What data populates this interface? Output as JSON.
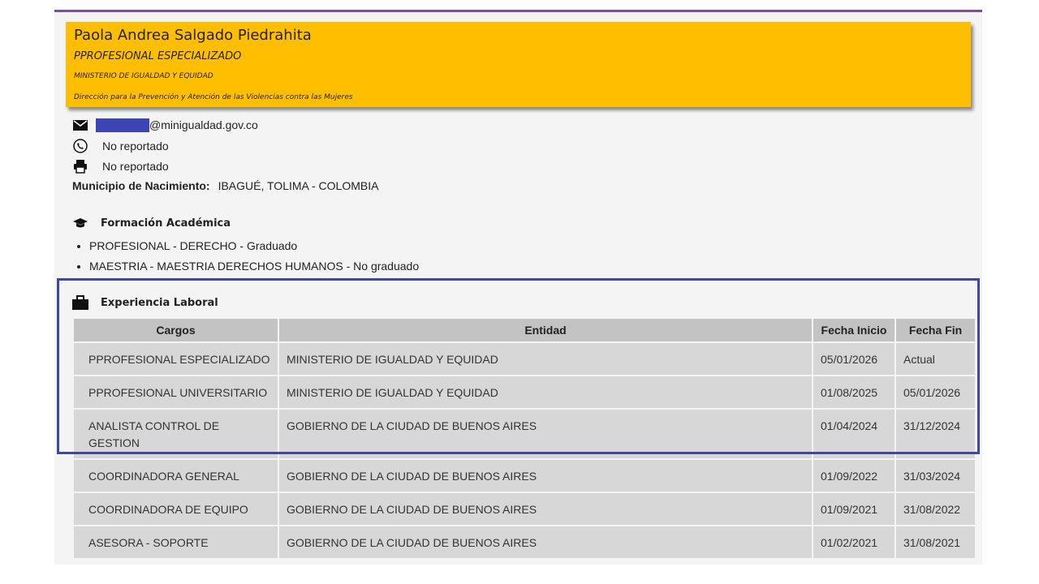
{
  "profile": {
    "name": "Paola Andrea Salgado Piedrahita",
    "role": "PPROFESIONAL ESPECIALIZADO",
    "organization": "MINISTERIO DE IGUALDAD Y EQUIDAD",
    "department": "Dirección para la Prevención y Atención de las Violencias contra las Mujeres"
  },
  "contact": {
    "email_domain": "@minigualdad.gov.co",
    "phone": "No reportado",
    "fax": "No reportado",
    "birthplace_label": "Municipio de Nacimiento:",
    "birthplace": "IBAGUÉ, TOLIMA - COLOMBIA"
  },
  "education": {
    "title": "Formación Académica",
    "items": [
      "PROFESIONAL - DERECHO - Graduado",
      "MAESTRIA - MAESTRIA DERECHOS HUMANOS - No graduado"
    ]
  },
  "experience": {
    "title": "Experiencia Laboral",
    "headers": [
      "Cargos",
      "Entidad",
      "Fecha Inicio",
      "Fecha Fin"
    ],
    "rows": [
      {
        "cargo": "PPROFESIONAL ESPECIALIZADO",
        "entidad": "MINISTERIO DE IGUALDAD Y EQUIDAD",
        "inicio": "05/01/2026",
        "fin": "Actual"
      },
      {
        "cargo": "PPROFESIONAL UNIVERSITARIO",
        "entidad": "MINISTERIO DE IGUALDAD Y EQUIDAD",
        "inicio": "01/08/2025",
        "fin": "05/01/2026"
      },
      {
        "cargo": "ANALISTA CONTROL DE GESTION",
        "entidad": "GOBIERNO DE LA CIUDAD DE BUENOS AIRES",
        "inicio": "01/04/2024",
        "fin": "31/12/2024"
      },
      {
        "cargo": "COORDINADORA GENERAL",
        "entidad": "GOBIERNO DE LA CIUDAD DE BUENOS AIRES",
        "inicio": "01/09/2022",
        "fin": "31/03/2024"
      },
      {
        "cargo": "COORDINADORA DE EQUIPO",
        "entidad": "GOBIERNO DE LA CIUDAD DE BUENOS AIRES",
        "inicio": "01/09/2021",
        "fin": "31/08/2022"
      },
      {
        "cargo": "ASESORA - SOPORTE",
        "entidad": "GOBIERNO DE LA CIUDAD DE BUENOS AIRES",
        "inicio": "01/02/2021",
        "fin": "31/08/2021"
      }
    ]
  },
  "colors": {
    "card": "#ffbf00",
    "highlight": "#3e47a6",
    "redaction": "#3b46b4",
    "top_rule": "#7b4f9d"
  },
  "icons": [
    "envelope-icon",
    "phone-icon",
    "printer-icon",
    "graduation-cap-icon",
    "briefcase-icon"
  ]
}
